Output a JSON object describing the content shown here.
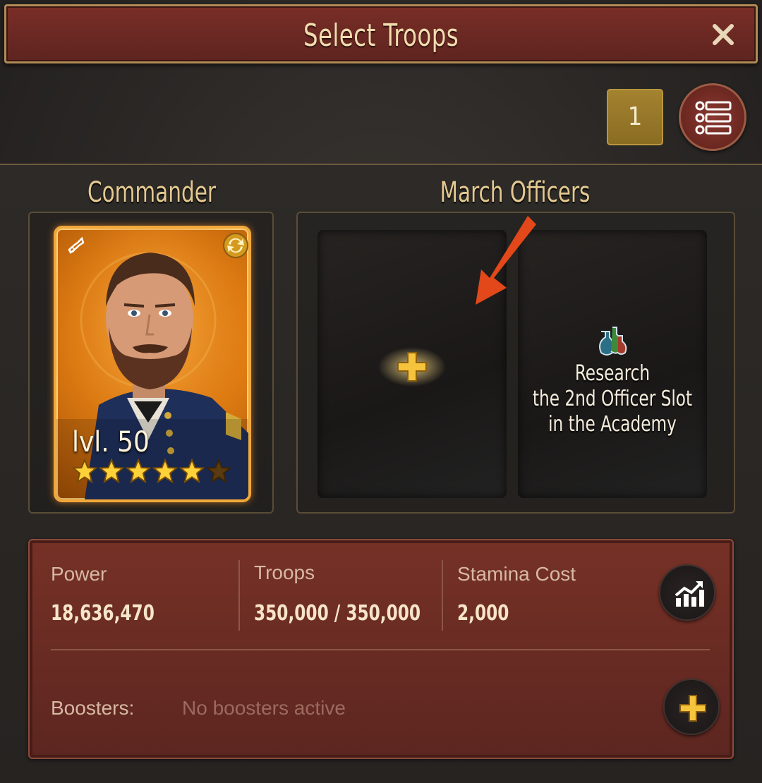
{
  "header": {
    "title": "Select Troops",
    "close_icon": "close-icon"
  },
  "top_controls": {
    "queue_count": "1",
    "list_icon": "checklist-icon"
  },
  "commander": {
    "title": "Commander",
    "level_label": "lvl. 50",
    "stars_filled": 5,
    "stars_total": 6,
    "icons": [
      "bugle-icon",
      "swap-icon"
    ],
    "card_color": "#e07d12"
  },
  "march_officers": {
    "title": "March Officers",
    "slot_1_icon": "plus-icon",
    "slot_2_icon": "potion-icon",
    "slot_2_text_lines": [
      "Research",
      "the 2nd Officer Slot",
      "in the Academy"
    ],
    "arrow_color": "#e2481a"
  },
  "stats": {
    "power_label": "Power",
    "power_value": "18,636,470",
    "troops_label": "Troops",
    "troops_value": "350,000 / 350,000",
    "stamina_label": "Stamina Cost",
    "stamina_value": "2,000",
    "stats_icon": "chart-up-icon",
    "boosters_label": "Boosters:",
    "boosters_value": "No boosters active",
    "boosters_icon": "plus-icon"
  },
  "colors": {
    "header_bg": "#6a2822",
    "accent_gold": "#e3c890",
    "stats_bg": "#6a2b23"
  }
}
